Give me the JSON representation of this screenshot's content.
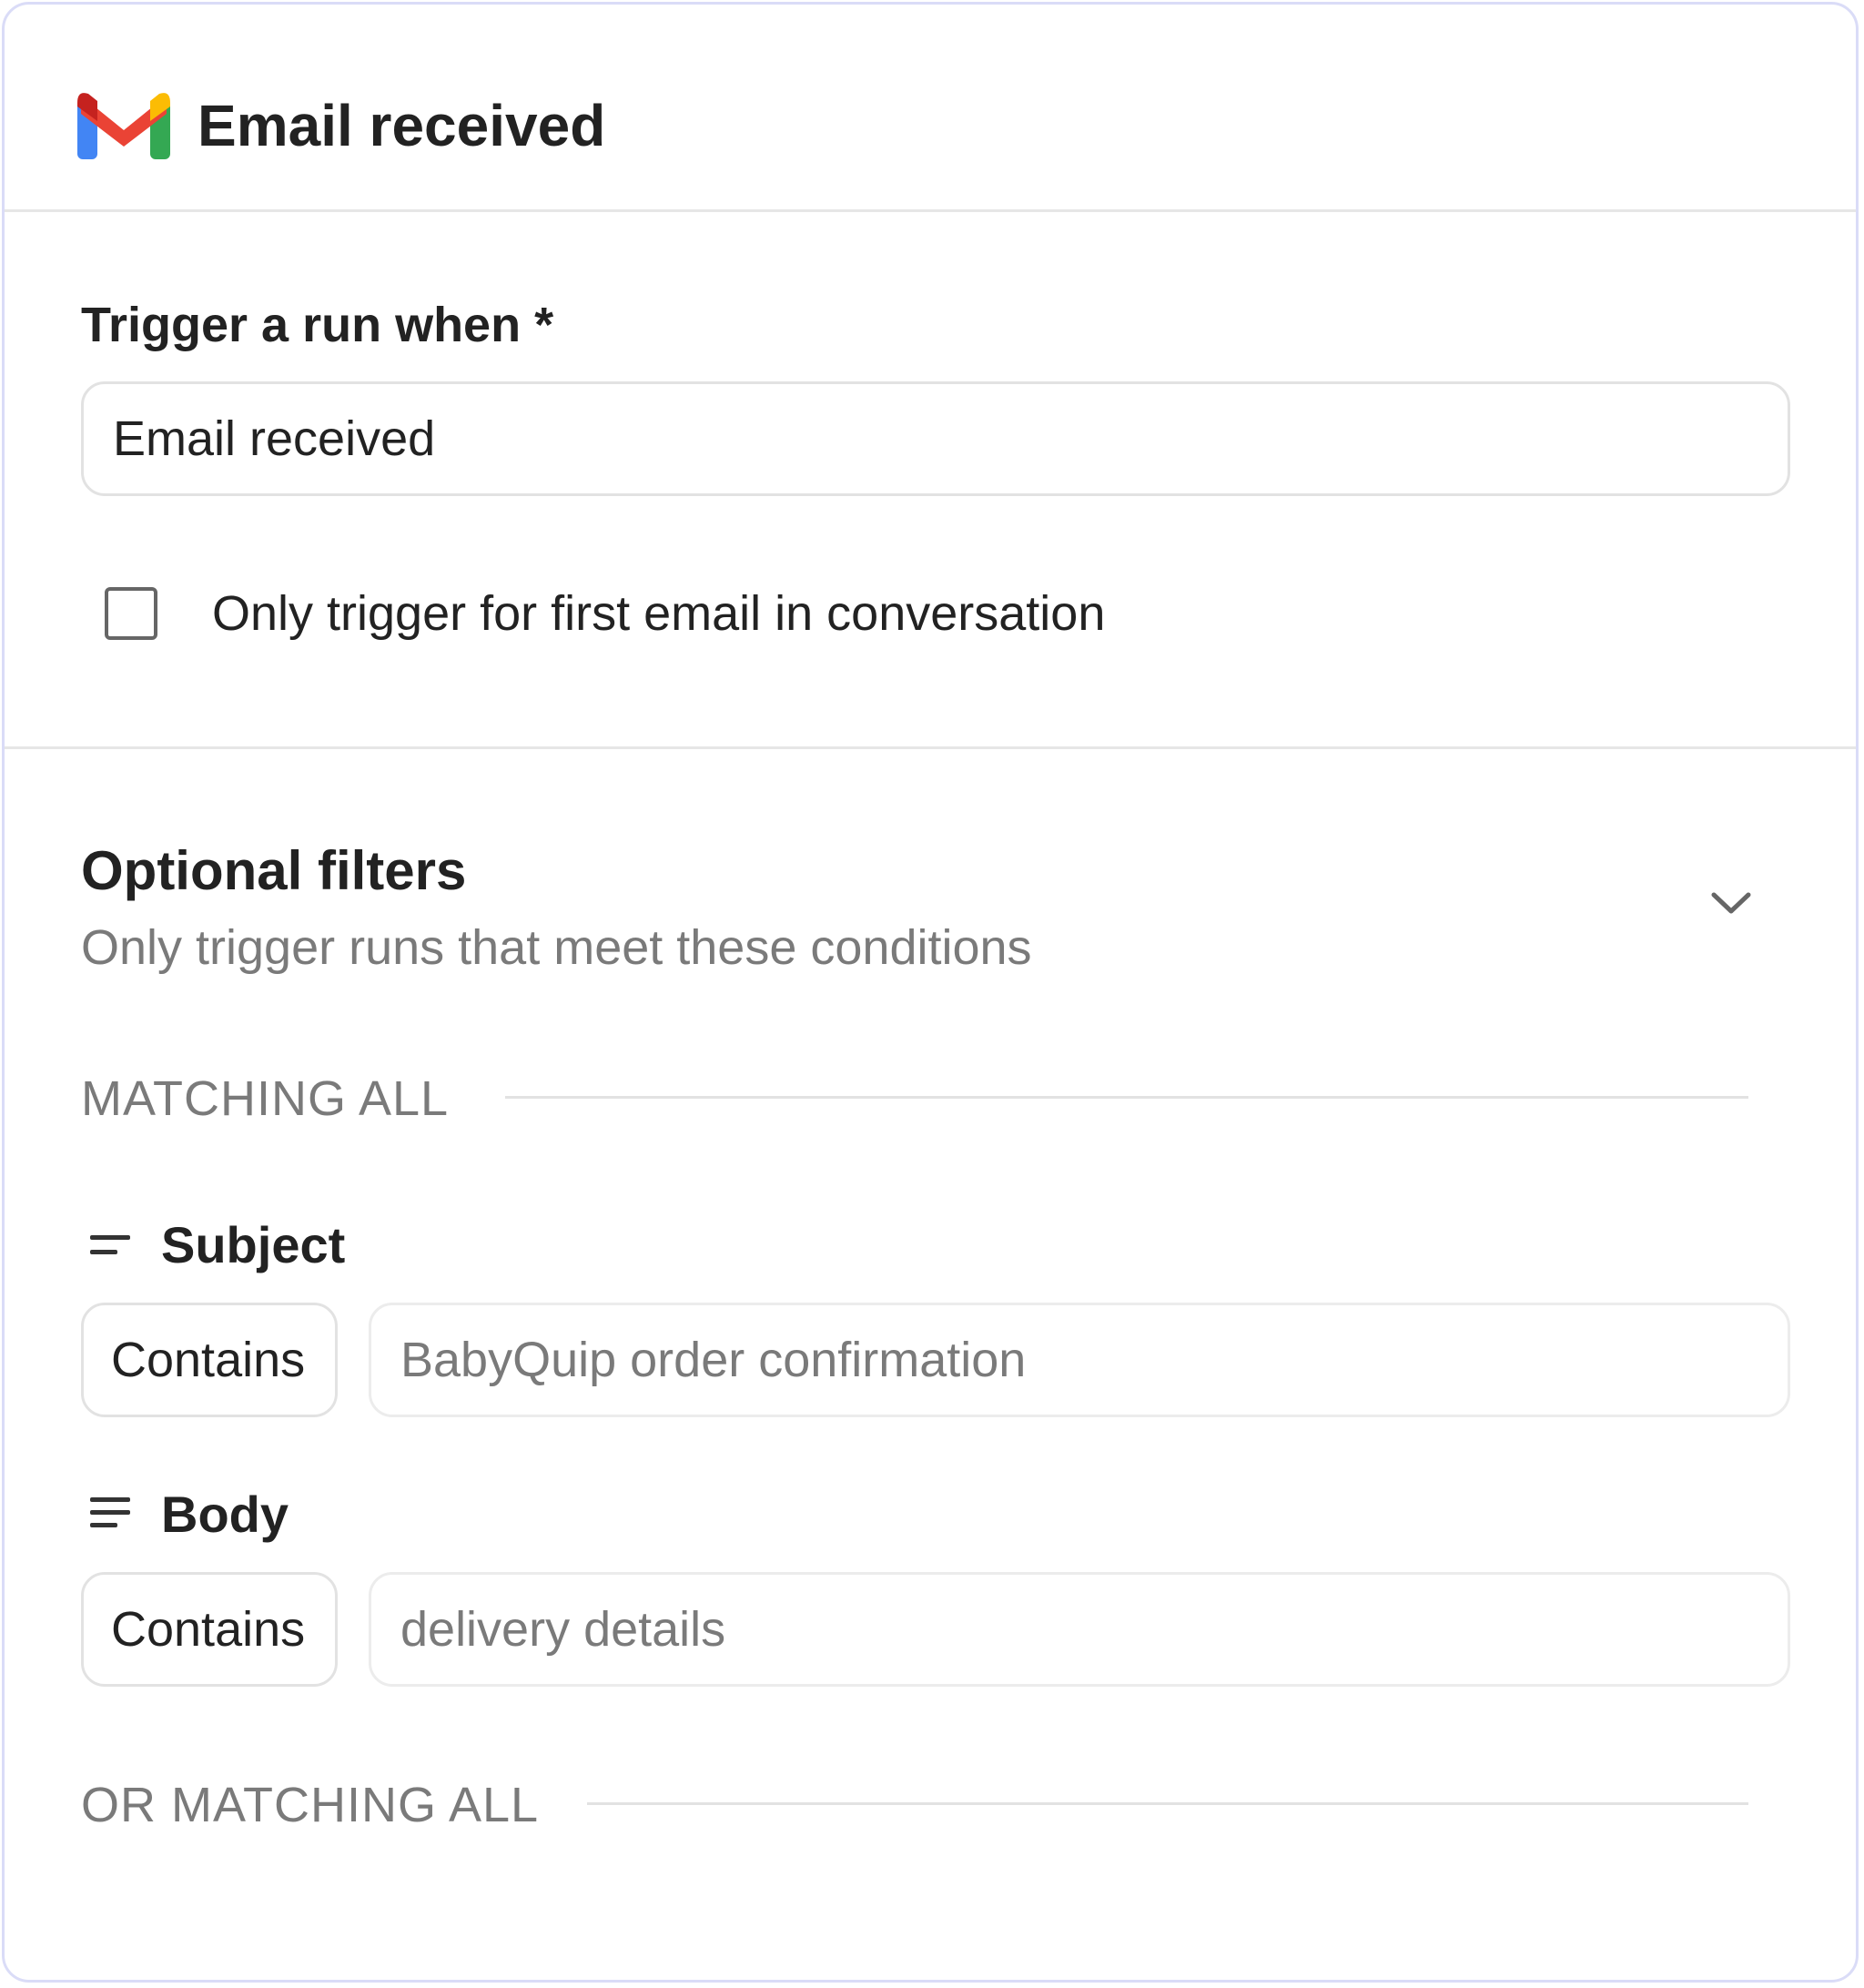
{
  "header": {
    "title": "Email received",
    "logo_icon": "gmail-icon"
  },
  "trigger": {
    "label": "Trigger a run when *",
    "selected_value": "Email received",
    "checkbox_label": "Only trigger for first email in conversation",
    "checkbox_checked": false
  },
  "filters": {
    "title": "Optional filters",
    "subtitle": "Only trigger runs that meet these conditions",
    "expand_icon": "chevron-down-icon",
    "groups": [
      {
        "label": "MATCHING ALL",
        "conditions": [
          {
            "field_icon": "short-text-icon",
            "field": "Subject",
            "operator": "Contains",
            "value_placeholder": "BabyQuip order confirmation"
          },
          {
            "field_icon": "long-text-icon",
            "field": "Body",
            "operator": "Contains",
            "value_placeholder": "delivery details"
          }
        ]
      },
      {
        "label": "OR MATCHING ALL",
        "conditions": []
      }
    ]
  },
  "colors": {
    "card_border": "#dadcf7",
    "divider": "#e6e6e6",
    "text_primary": "#222222",
    "text_secondary": "#7a7a7a",
    "gmail_blue": "#4285F4",
    "gmail_red": "#EA4335",
    "gmail_yellow": "#FBBC04",
    "gmail_green": "#34A853"
  }
}
